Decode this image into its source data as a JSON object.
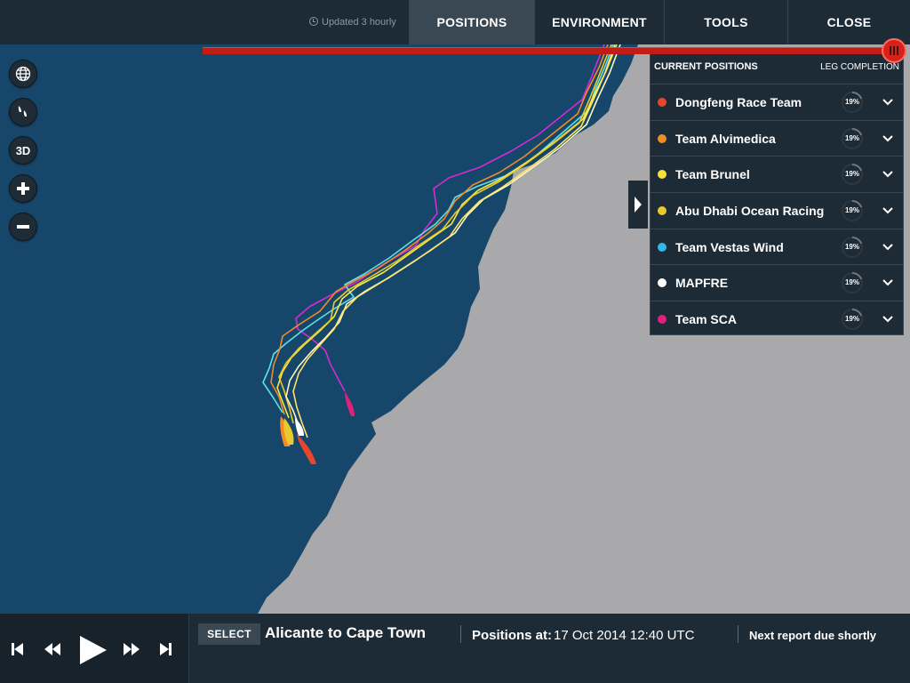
{
  "header": {
    "updated_text": "Updated 3 hourly",
    "tabs": [
      {
        "label": "POSITIONS",
        "active": true
      },
      {
        "label": "ENVIRONMENT",
        "active": false
      },
      {
        "label": "TOOLS",
        "active": false
      },
      {
        "label": "CLOSE",
        "active": false
      }
    ]
  },
  "map_controls": [
    {
      "icon": "globe-icon"
    },
    {
      "icon": "boats-icon"
    },
    {
      "label": "3D"
    },
    {
      "icon": "zoom-in-icon"
    },
    {
      "icon": "zoom-out-icon"
    }
  ],
  "colors": {
    "sea": "#17466b",
    "land": "#a9a9ab",
    "panel": "#1d2b36",
    "accent_red": "#c01d16"
  },
  "positions_panel": {
    "title": "CURRENT POSITIONS",
    "right_header": "LEG COMPLETION",
    "teams": [
      {
        "name": "Dongfeng Race Team",
        "color": "#e8462a",
        "completion": "19%",
        "completion_value": 19
      },
      {
        "name": "Team Alvimedica",
        "color": "#f28c28",
        "completion": "19%",
        "completion_value": 19
      },
      {
        "name": "Team Brunel",
        "color": "#f4e33a",
        "completion": "19%",
        "completion_value": 19
      },
      {
        "name": "Abu Dhabi Ocean Racing",
        "color": "#e9c830",
        "completion": "19%",
        "completion_value": 19
      },
      {
        "name": "Team Vestas Wind",
        "color": "#34b6e8",
        "completion": "19%",
        "completion_value": 19
      },
      {
        "name": "MAPFRE",
        "color": "#ffffff",
        "completion": "19%",
        "completion_value": 19
      },
      {
        "name": "Team SCA",
        "color": "#e0207a",
        "completion": "19%",
        "completion_value": 19
      }
    ]
  },
  "bottom_bar": {
    "select_label": "SELECT",
    "leg_title": "Alicante to Cape Town",
    "positions_label": "Positions at:",
    "positions_time": "17 Oct 2014 12:40 UTC",
    "next_report": "Next report due shortly",
    "timeline_progress": 1.0
  }
}
